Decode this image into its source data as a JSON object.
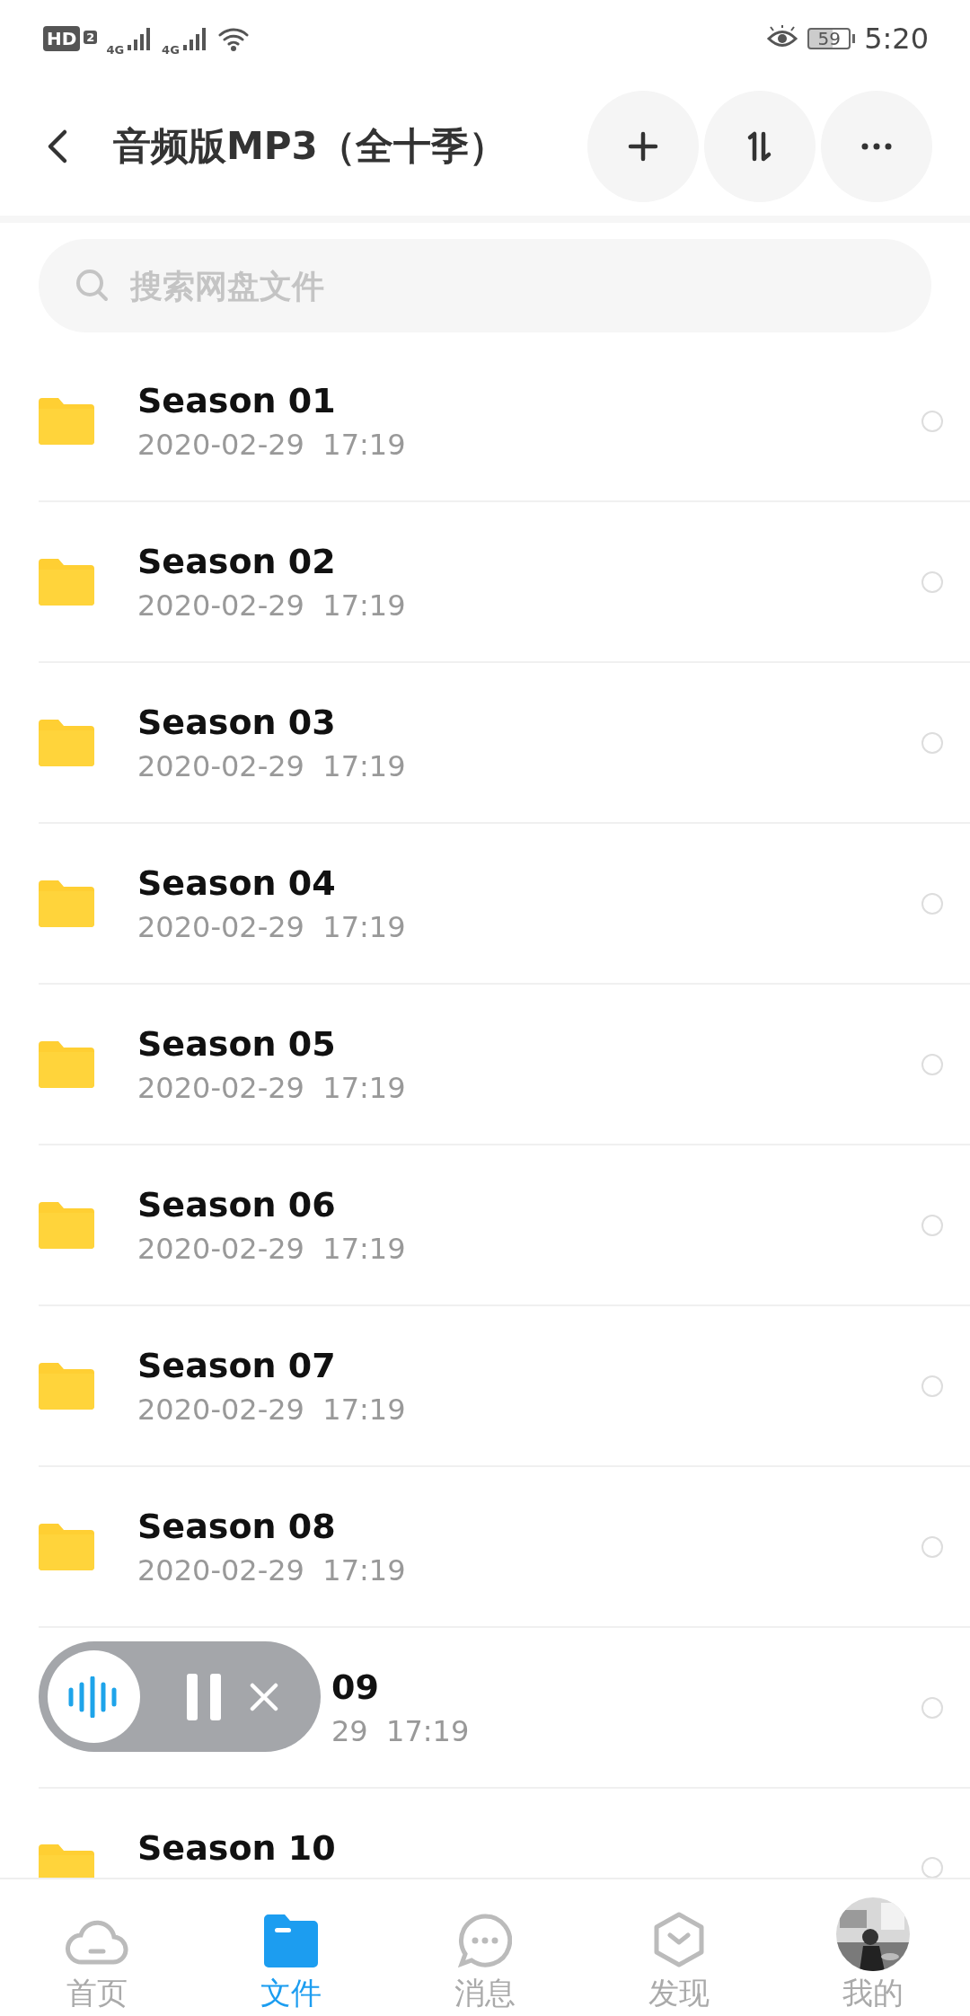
{
  "status_bar": {
    "hd": "HD",
    "sim": "2",
    "networks": [
      "4G",
      "4G"
    ],
    "battery": "59",
    "time": "5:20"
  },
  "header": {
    "title": "音频版MP3（全十季）"
  },
  "search": {
    "placeholder": "搜索网盘文件"
  },
  "files": [
    {
      "name": "Season 01",
      "date": "2020-02-29  17:19",
      "selected": false
    },
    {
      "name": "Season 02",
      "date": "2020-02-29  17:19",
      "selected": false
    },
    {
      "name": "Season 03",
      "date": "2020-02-29  17:19",
      "selected": false
    },
    {
      "name": "Season 04",
      "date": "2020-02-29  17:19",
      "selected": false
    },
    {
      "name": "Season 05",
      "date": "2020-02-29  17:19",
      "selected": false
    },
    {
      "name": "Season 06",
      "date": "2020-02-29  17:19",
      "selected": false
    },
    {
      "name": "Season 07",
      "date": "2020-02-29  17:19",
      "selected": false
    },
    {
      "name": "Season 08",
      "date": "2020-02-29  17:19",
      "selected": false
    },
    {
      "name": "09",
      "date": "29  17:19",
      "covered": true,
      "selected": false
    },
    {
      "name": "Season 10",
      "selected": false
    }
  ],
  "player": {
    "playing": true
  },
  "nav": [
    {
      "label": "首页",
      "kind": "cloud",
      "selected": false
    },
    {
      "label": "文件",
      "kind": "folder",
      "selected": true
    },
    {
      "label": "消息",
      "kind": "chat",
      "selected": false
    },
    {
      "label": "发现",
      "kind": "discover",
      "selected": false
    },
    {
      "label": "我的",
      "kind": "avatar",
      "selected": false
    }
  ]
}
